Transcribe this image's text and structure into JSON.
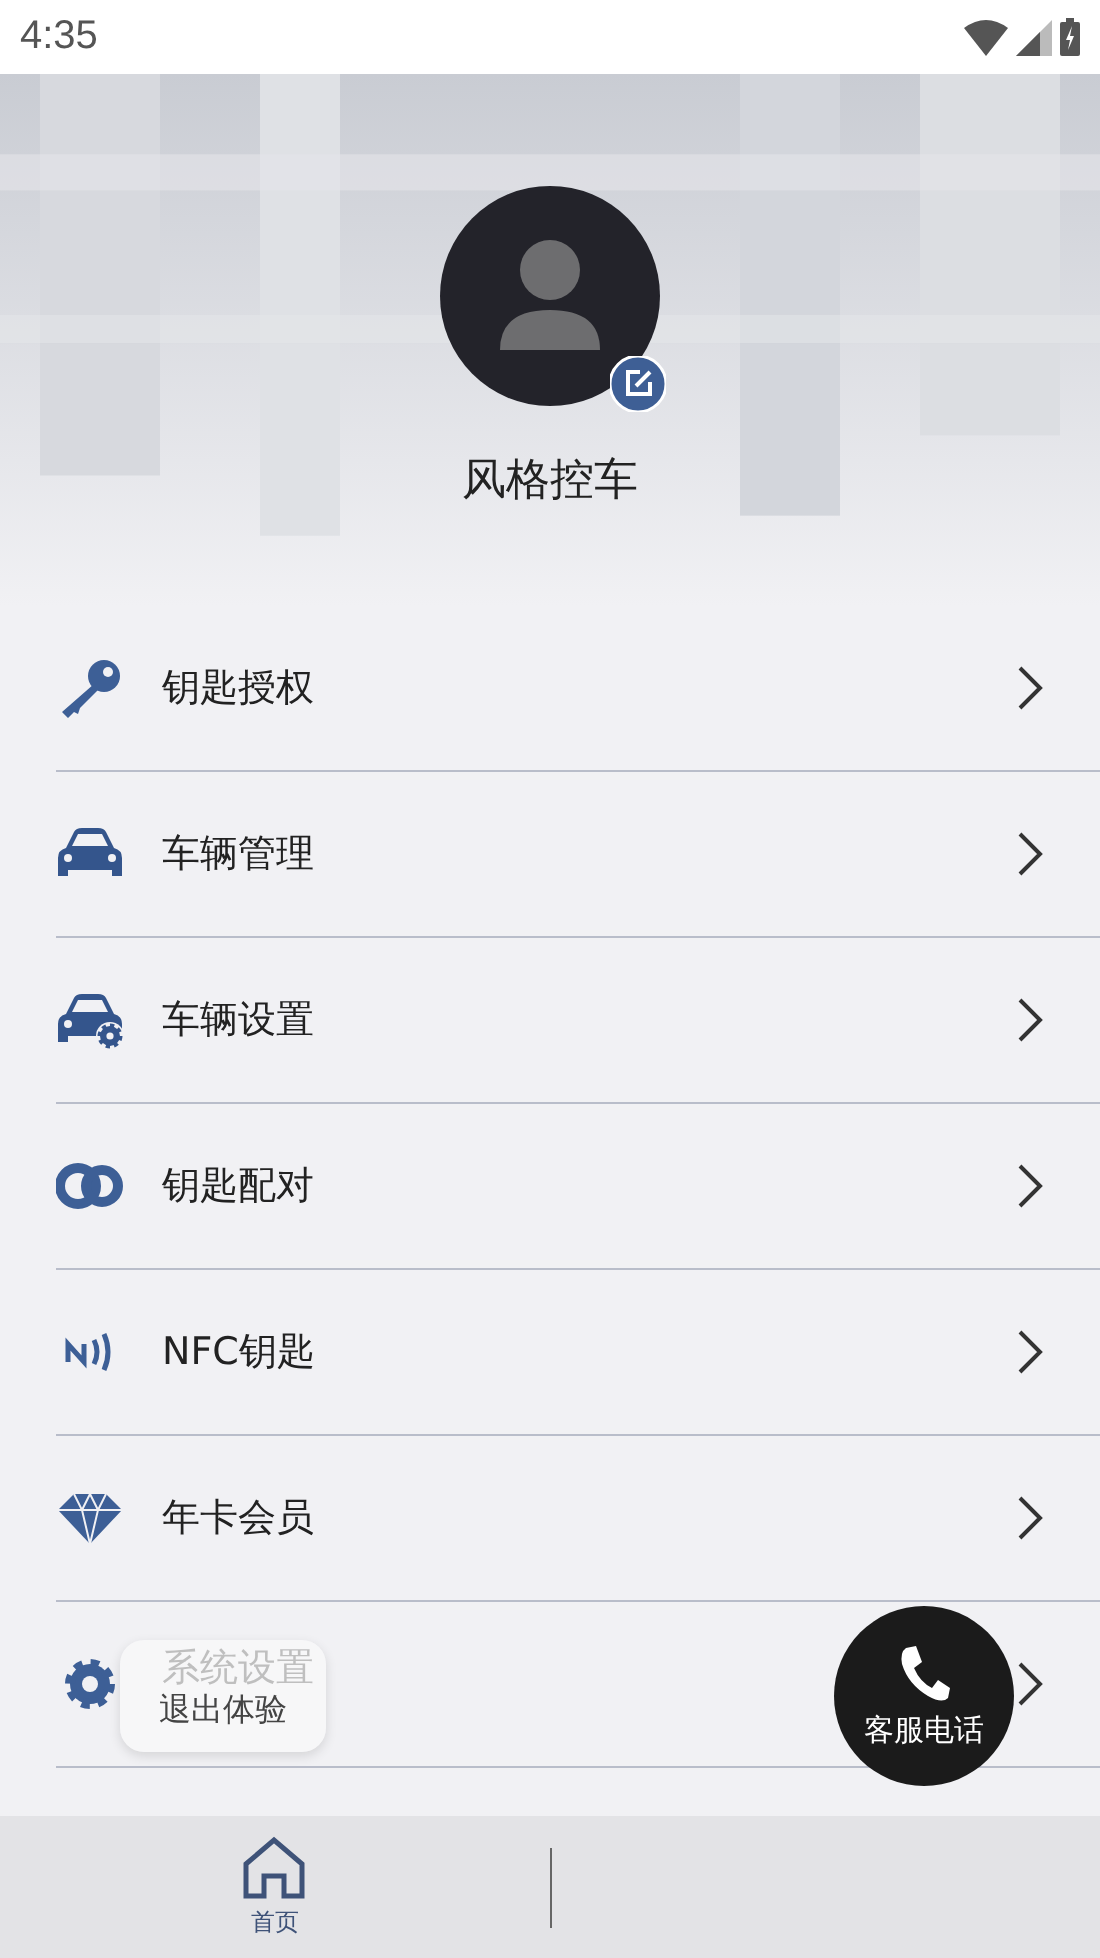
{
  "status_bar": {
    "time": "4:35"
  },
  "profile": {
    "name": "风格控车"
  },
  "menu": [
    {
      "kind": "key",
      "label": "钥匙授权"
    },
    {
      "kind": "car",
      "label": "车辆管理"
    },
    {
      "kind": "car-gear",
      "label": "车辆设置"
    },
    {
      "kind": "pair",
      "label": "钥匙配对"
    },
    {
      "kind": "nfc",
      "label": "NFC钥匙"
    },
    {
      "kind": "diamond",
      "label": "年卡会员"
    },
    {
      "kind": "gear",
      "label": "系统设置"
    }
  ],
  "toast": "退出体验",
  "call_button": {
    "label": "客服电话"
  },
  "tabs": [
    {
      "label": "首页",
      "selected": true
    }
  ]
}
